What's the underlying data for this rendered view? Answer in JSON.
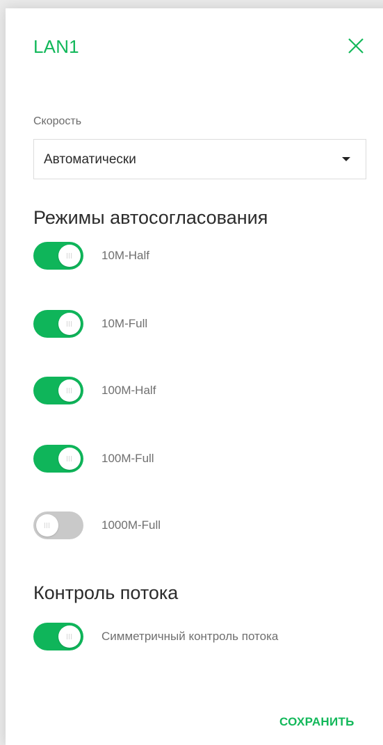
{
  "header": {
    "title": "LAN1",
    "close_icon": "close-icon"
  },
  "speed": {
    "label": "Скорость",
    "selected": "Автоматически"
  },
  "autoneg": {
    "title": "Режимы автосогласования",
    "modes": [
      {
        "label": "10M-Half",
        "enabled": true
      },
      {
        "label": "10M-Full",
        "enabled": true
      },
      {
        "label": "100M-Half",
        "enabled": true
      },
      {
        "label": "100M-Full",
        "enabled": true
      },
      {
        "label": "1000M-Full",
        "enabled": false
      }
    ]
  },
  "flow": {
    "title": "Контроль потока",
    "symmetric": {
      "label": "Симметричный контроль потока",
      "enabled": true
    }
  },
  "footer": {
    "save_label": "СОХРАНИТЬ"
  },
  "colors": {
    "accent": "#12b85a",
    "toggle_off": "#c9c9c9"
  }
}
